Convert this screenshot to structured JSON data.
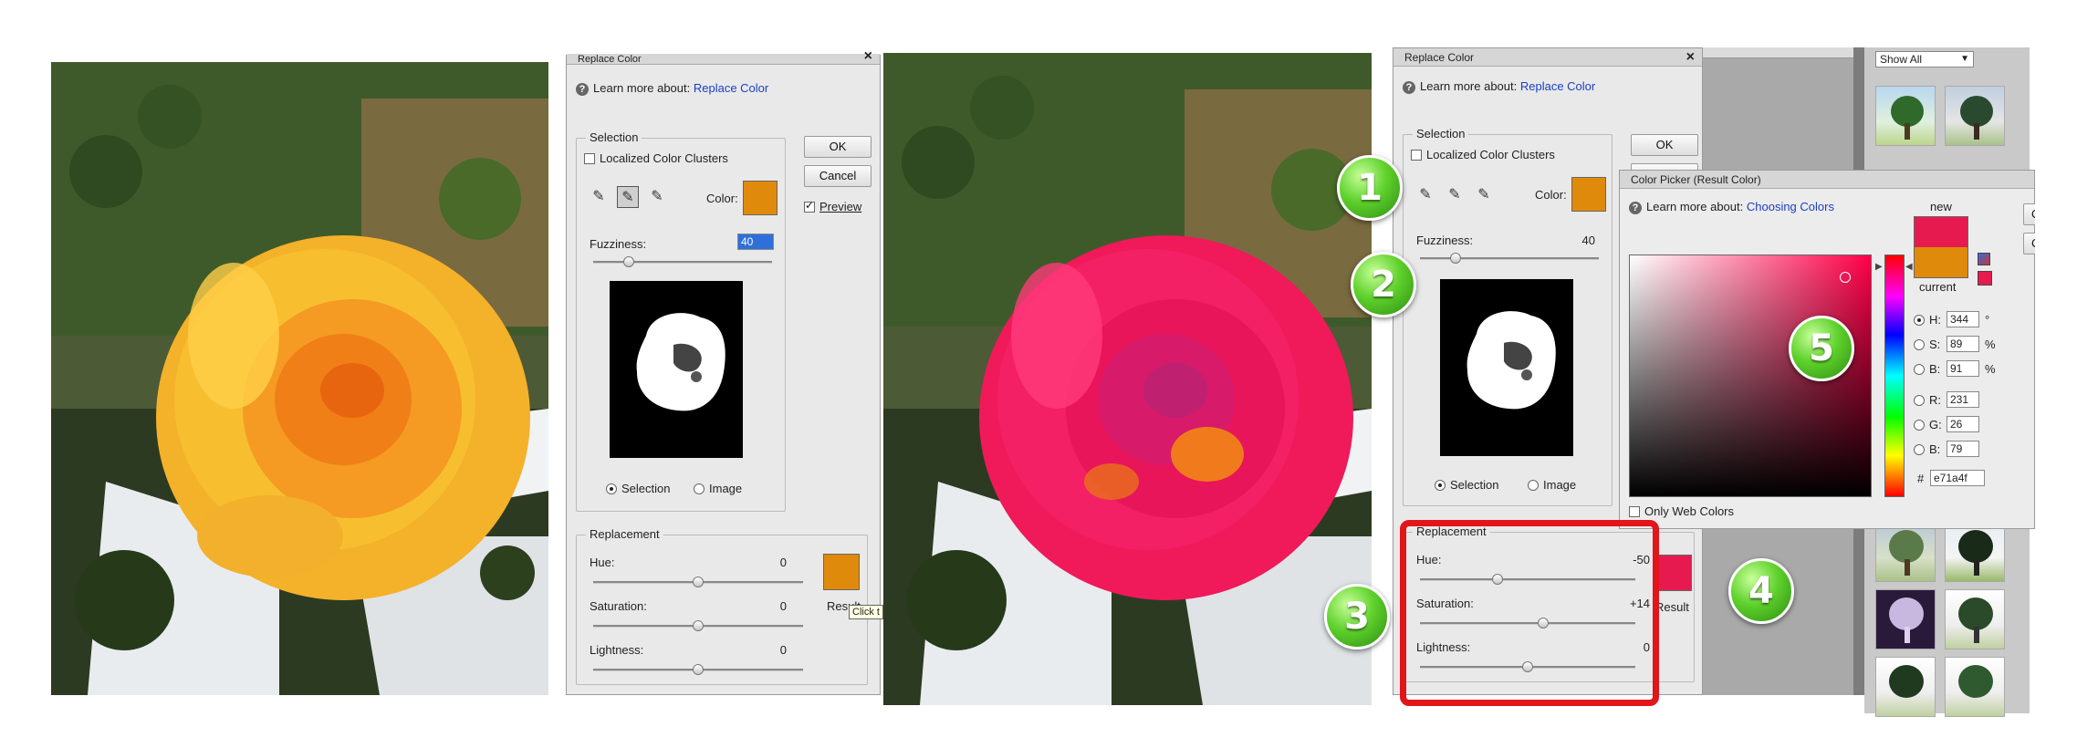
{
  "left_dialog": {
    "title": "Replace Color",
    "help_prefix": "Learn more about:",
    "help_link": "Replace Color",
    "selection_label": "Selection",
    "localized_label": "Localized Color Clusters",
    "color_label": "Color:",
    "fuzziness_label": "Fuzziness:",
    "fuzziness_value": "40",
    "ok": "OK",
    "cancel": "Cancel",
    "preview": "Preview",
    "radio_selection": "Selection",
    "radio_image": "Image",
    "replacement_label": "Replacement",
    "hue_label": "Hue:",
    "hue_value": "0",
    "saturation_label": "Saturation:",
    "saturation_value": "0",
    "lightness_label": "Lightness:",
    "lightness_value": "0",
    "result_label": "Result",
    "tooltip": "Click t",
    "selected_color": "#e08a0c"
  },
  "right_dialog": {
    "title": "Replace Color",
    "help_prefix": "Learn more about:",
    "help_link": "Replace Color",
    "selection_label": "Selection",
    "localized_label": "Localized Color Clusters",
    "color_label": "Color:",
    "fuzziness_label": "Fuzziness:",
    "fuzziness_value": "40",
    "ok": "OK",
    "radio_selection": "Selection",
    "radio_image": "Image",
    "replacement_label": "Replacement",
    "hue_label": "Hue:",
    "hue_value": "-50",
    "saturation_label": "Saturation:",
    "saturation_value": "+14",
    "lightness_label": "Lightness:",
    "lightness_value": "0",
    "result_label": "Result",
    "selected_color": "#e08a0c",
    "result_color": "#e71a4f"
  },
  "color_picker": {
    "title": "Color Picker (Result Color)",
    "help_prefix": "Learn more about:",
    "help_link": "Choosing Colors",
    "new_label": "new",
    "current_label": "current",
    "new_color": "#e71a4f",
    "current_color": "#e08a0c",
    "h_label": "H:",
    "h_value": "344",
    "h_unit": "°",
    "s_label": "S:",
    "s_value": "89",
    "s_unit": "%",
    "b_label": "B:",
    "b_value": "91",
    "b_unit": "%",
    "r_label": "R:",
    "r_value": "231",
    "g_label": "G:",
    "g_value": "26",
    "bb_label": "B:",
    "bb_value": "79",
    "hex_label": "#",
    "hex_value": "e71a4f",
    "web_colors": "Only Web Colors",
    "ok_partial": "O",
    "cancel_partial": "Ca"
  },
  "right_panel": {
    "dropdown": "Show All"
  },
  "badges": [
    "1",
    "2",
    "3",
    "4",
    "5"
  ],
  "colors": {
    "highlight": "#e0161b",
    "badge_green": "#5fd12c",
    "link_blue": "#1a3fc4"
  }
}
